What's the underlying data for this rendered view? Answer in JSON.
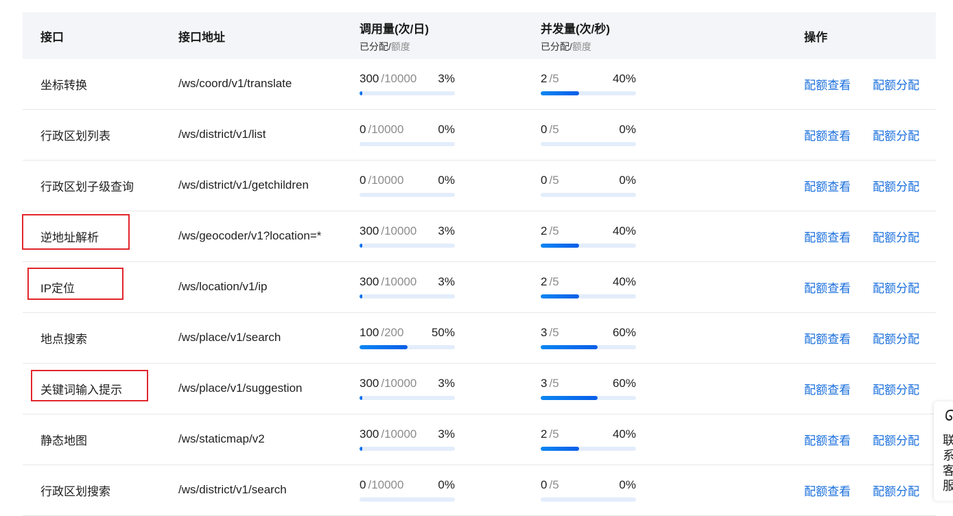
{
  "header": {
    "col_name": "接口",
    "col_addr": "接口地址",
    "col_call": "调用量(次/日)",
    "col_conc": "并发量(次/秒)",
    "col_sub_used": "已分配/",
    "col_sub_quota": "额度",
    "col_ops": "操作"
  },
  "rows": [
    {
      "name": "坐标转换",
      "addr": "/ws/coord/v1/translate",
      "call_used": "300",
      "call_quota": "/10000",
      "call_pct": "3%",
      "call_frac": 0.03,
      "conc_used": "2",
      "conc_quota": "/5",
      "conc_pct": "40%",
      "conc_frac": 0.4,
      "highlighted": false
    },
    {
      "name": "行政区划列表",
      "addr": "/ws/district/v1/list",
      "call_used": "0",
      "call_quota": "/10000",
      "call_pct": "0%",
      "call_frac": 0.0,
      "conc_used": "0",
      "conc_quota": "/5",
      "conc_pct": "0%",
      "conc_frac": 0.0,
      "highlighted": false
    },
    {
      "name": "行政区划子级查询",
      "addr": "/ws/district/v1/getchildren",
      "call_used": "0",
      "call_quota": "/10000",
      "call_pct": "0%",
      "call_frac": 0.0,
      "conc_used": "0",
      "conc_quota": "/5",
      "conc_pct": "0%",
      "conc_frac": 0.0,
      "highlighted": false
    },
    {
      "name": "逆地址解析",
      "addr": "/ws/geocoder/v1?location=*",
      "call_used": "300",
      "call_quota": "/10000",
      "call_pct": "3%",
      "call_frac": 0.03,
      "conc_used": "2",
      "conc_quota": "/5",
      "conc_pct": "40%",
      "conc_frac": 0.4,
      "highlighted": true
    },
    {
      "name": "IP定位",
      "addr": "/ws/location/v1/ip",
      "call_used": "300",
      "call_quota": "/10000",
      "call_pct": "3%",
      "call_frac": 0.03,
      "conc_used": "2",
      "conc_quota": "/5",
      "conc_pct": "40%",
      "conc_frac": 0.4,
      "highlighted": true
    },
    {
      "name": "地点搜索",
      "addr": "/ws/place/v1/search",
      "call_used": "100",
      "call_quota": "/200",
      "call_pct": "50%",
      "call_frac": 0.5,
      "conc_used": "3",
      "conc_quota": "/5",
      "conc_pct": "60%",
      "conc_frac": 0.6,
      "highlighted": false
    },
    {
      "name": "关键词输入提示",
      "addr": "/ws/place/v1/suggestion",
      "call_used": "300",
      "call_quota": "/10000",
      "call_pct": "3%",
      "call_frac": 0.03,
      "conc_used": "3",
      "conc_quota": "/5",
      "conc_pct": "60%",
      "conc_frac": 0.6,
      "highlighted": true
    },
    {
      "name": "静态地图",
      "addr": "/ws/staticmap/v2",
      "call_used": "300",
      "call_quota": "/10000",
      "call_pct": "3%",
      "call_frac": 0.03,
      "conc_used": "2",
      "conc_quota": "/5",
      "conc_pct": "40%",
      "conc_frac": 0.4,
      "highlighted": false
    },
    {
      "name": "行政区划搜索",
      "addr": "/ws/district/v1/search",
      "call_used": "0",
      "call_quota": "/10000",
      "call_pct": "0%",
      "call_frac": 0.0,
      "conc_used": "0",
      "conc_quota": "/5",
      "conc_pct": "0%",
      "conc_frac": 0.0,
      "highlighted": false
    }
  ],
  "actions": {
    "view": "配额查看",
    "assign": "配额分配"
  },
  "side_widget": {
    "icon": "headset-icon",
    "label": "联系客服"
  },
  "colors": {
    "link": "#1a6fdc",
    "bar_fill": "#0a86f2",
    "bar_track": "#e3edfb",
    "highlight": "#e2262c",
    "header_bg": "#f3f5f8"
  }
}
